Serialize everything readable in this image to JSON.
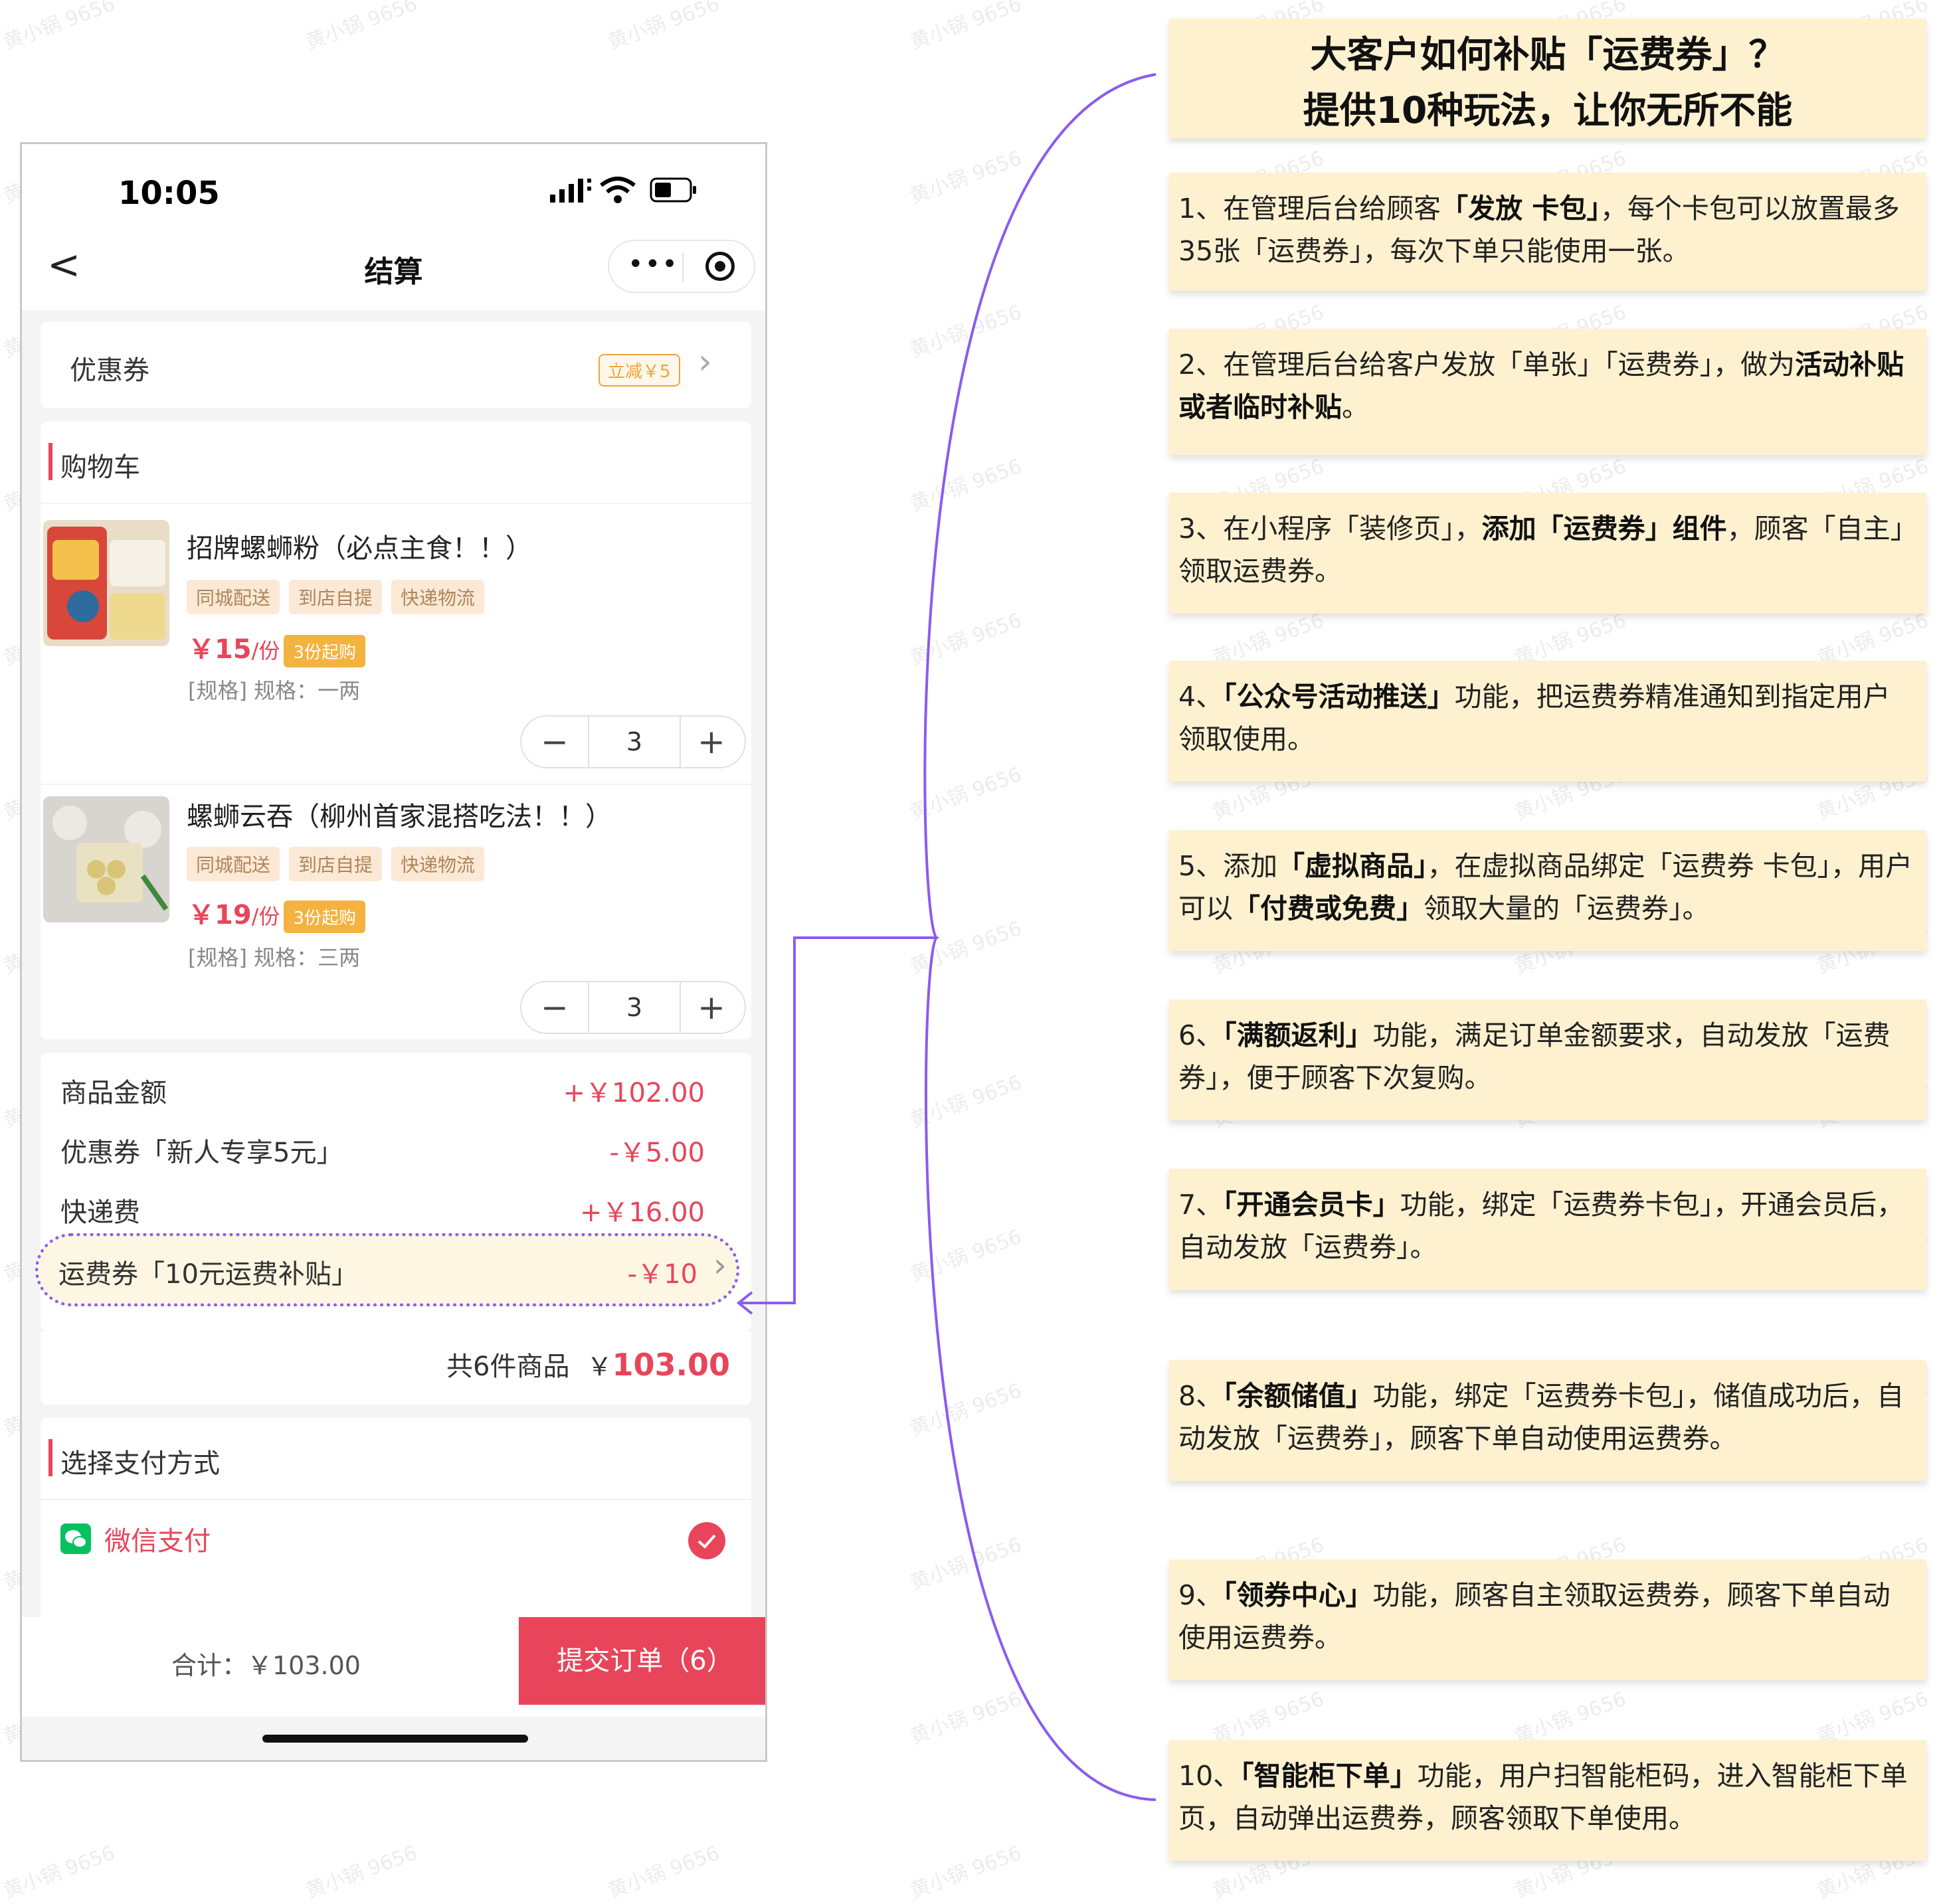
{
  "watermark": "黄小锅 9656",
  "phone": {
    "status": {
      "time": "10:05"
    },
    "nav": {
      "back_glyph": "<",
      "title": "结算",
      "more_glyph": "•••"
    },
    "coupon": {
      "label": "优惠券",
      "badge": "立减￥5"
    },
    "cart": {
      "title": "购物车",
      "items": [
        {
          "name": "招牌螺蛳粉（必点主食！！）",
          "tags": [
            "同城配送",
            "到店自提",
            "快递物流"
          ],
          "price": "￥15",
          "unit": "/份",
          "min_badge": "3份起购",
          "spec": "[规格] 规格：一两",
          "qty": "3"
        },
        {
          "name": "螺蛳云吞（柳州首家混搭吃法！！）",
          "tags": [
            "同城配送",
            "到店自提",
            "快递物流"
          ],
          "price": "￥19",
          "unit": "/份",
          "min_badge": "3份起购",
          "spec": "[规格] 规格：三两",
          "qty": "3"
        }
      ],
      "minus_glyph": "−",
      "plus_glyph": "+"
    },
    "summary": {
      "rows": [
        {
          "label": "商品金额",
          "value": "+￥102.00"
        },
        {
          "label": "优惠券「新人专享5元」",
          "value": "-￥5.00"
        },
        {
          "label": "快递费",
          "value": "+￥16.00"
        },
        {
          "label": "运费券「10元运费补贴」",
          "value": "-￥10"
        }
      ],
      "total_count": "共6件商品",
      "total_currency": "￥",
      "total_amount": "103.00"
    },
    "payment": {
      "title": "选择支付方式",
      "method": "微信支付"
    },
    "footer": {
      "total": "合计：￥103.00",
      "submit": "提交订单（6）"
    }
  },
  "panel": {
    "title_line1": "大客户如何补贴「运费券」？",
    "title_line2": "提供10种玩法，让你无所不能",
    "notes": [
      {
        "parts": [
          {
            "t": "1、在管理后台给顾客"
          },
          {
            "t": "「发放 卡包」",
            "b": true
          },
          {
            "t": "，每个卡包可以放置最多35张「运费券」，每次下单只能使用一张。"
          }
        ]
      },
      {
        "parts": [
          {
            "t": "2、在管理后台给客户发放「单张」「运费券」，做为"
          },
          {
            "t": "活动补贴或者临时补贴",
            "b": true
          },
          {
            "t": "。"
          }
        ]
      },
      {
        "parts": [
          {
            "t": "3、在小程序「装修页」，"
          },
          {
            "t": "添加「运费券」组件",
            "b": true
          },
          {
            "t": "，顾客「自主」领取运费券。"
          }
        ]
      },
      {
        "parts": [
          {
            "t": "4、"
          },
          {
            "t": "「公众号活动推送」",
            "b": true
          },
          {
            "t": "功能，把运费券精准通知到指定用户领取使用。"
          }
        ]
      },
      {
        "parts": [
          {
            "t": "5、添加"
          },
          {
            "t": "「虚拟商品」",
            "b": true
          },
          {
            "t": "，在虚拟商品绑定「运费券 卡包」，用户可以"
          },
          {
            "t": "「付费或免费」",
            "b": true
          },
          {
            "t": "领取大量的「运费券」。"
          }
        ]
      },
      {
        "parts": [
          {
            "t": "6、"
          },
          {
            "t": "「满额返利」",
            "b": true
          },
          {
            "t": "功能，满足订单金额要求，自动发放「运费券」，便于顾客下次复购。"
          }
        ]
      },
      {
        "parts": [
          {
            "t": "7、"
          },
          {
            "t": "「开通会员卡」",
            "b": true
          },
          {
            "t": "功能，绑定「运费券卡包」，开通会员后，自动发放「运费券」。"
          }
        ]
      },
      {
        "parts": [
          {
            "t": "8、"
          },
          {
            "t": "「余额储值」",
            "b": true
          },
          {
            "t": "功能，绑定「运费券卡包」，储值成功后，自动发放「运费券」，顾客下单自动使用运费券。"
          }
        ]
      },
      {
        "parts": [
          {
            "t": "9、"
          },
          {
            "t": "「领券中心」",
            "b": true
          },
          {
            "t": "功能，顾客自主领取运费券，顾客下单自动使用运费券。"
          }
        ]
      },
      {
        "parts": [
          {
            "t": "10、"
          },
          {
            "t": "「智能柜下单」",
            "b": true
          },
          {
            "t": "功能，用户扫智能柜码，进入智能柜下单页，自动弹出运费券，顾客领取下单使用。"
          }
        ]
      }
    ]
  },
  "colors": {
    "accent": "#e8455b",
    "bracket": "#8a5cf0",
    "note_bg": "#fdf1d0",
    "wechat": "#07c160"
  }
}
